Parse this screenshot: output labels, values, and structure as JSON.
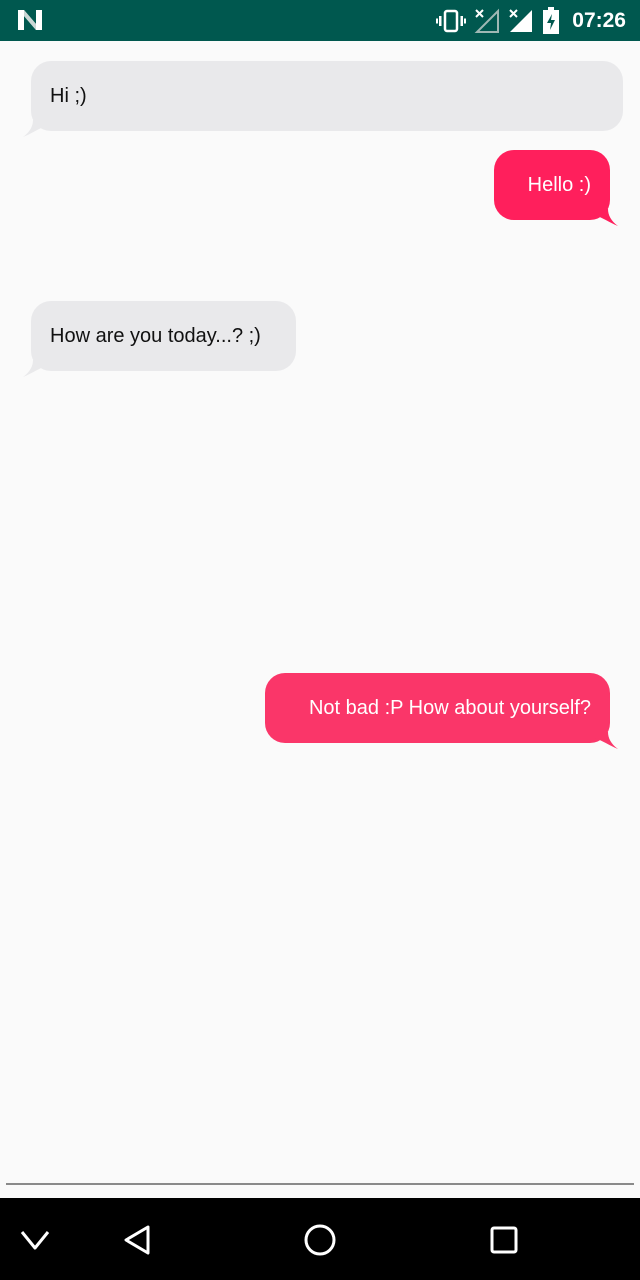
{
  "status_bar": {
    "time": "07:26",
    "icons": [
      "n-logo-icon",
      "vibrate-icon",
      "no-signal-icon",
      "signal-icon",
      "battery-charging-icon"
    ]
  },
  "messages": [
    {
      "sender": "incoming",
      "text": "Hi ;)"
    },
    {
      "sender": "outgoing",
      "text": "Hello :)"
    },
    {
      "sender": "incoming",
      "text": "How are you today...? ;)"
    },
    {
      "sender": "outgoing",
      "text": "Not bad :P How about yourself?"
    }
  ],
  "nav_bar": {
    "icons": [
      "chevron-down-icon",
      "back-icon",
      "home-icon",
      "recents-icon"
    ]
  },
  "colors": {
    "status_bar": "#00584f",
    "incoming_bubble": "#e9e9eb",
    "outgoing_bubble_1": "#ff1f5c",
    "outgoing_bubble_2": "#fa3669",
    "background": "#fafafa",
    "nav_bar": "#000000"
  }
}
